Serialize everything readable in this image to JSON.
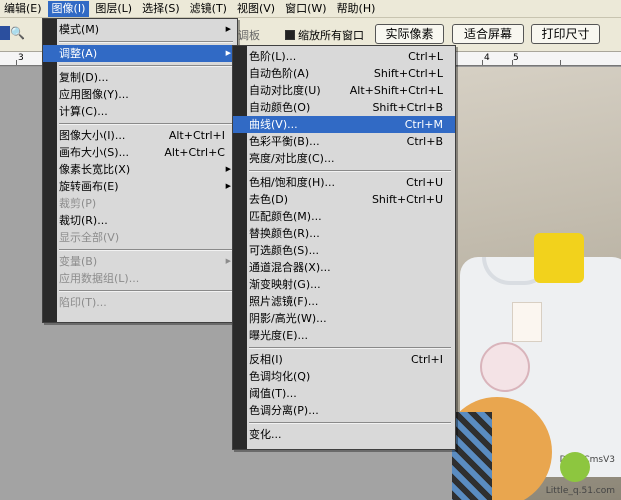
{
  "menubar": {
    "items": [
      {
        "label": "编辑(E)"
      },
      {
        "label": "图像(I)"
      },
      {
        "label": "图层(L)"
      },
      {
        "label": "选择(S)"
      },
      {
        "label": "滤镜(T)"
      },
      {
        "label": "视图(V)"
      },
      {
        "label": "窗口(W)"
      },
      {
        "label": "帮助(H)"
      }
    ],
    "active_index": 1
  },
  "options_bar": {
    "zoom_glyph": "🔍",
    "adjust_label": "调板",
    "zoom_all_windows": "缩放所有窗口",
    "actual_pixels": "实际像素",
    "fit_screen": "适合屏幕",
    "print_size": "打印尺寸"
  },
  "ruler": {
    "ticks": [
      "3",
      "1",
      "4",
      "5"
    ]
  },
  "image_menu": {
    "items": [
      {
        "label": "模式(M)",
        "shortcut": "",
        "submenu": true
      },
      {
        "separator": true
      },
      {
        "label": "调整(A)",
        "shortcut": "",
        "submenu": true,
        "highlight": true
      },
      {
        "separator": true
      },
      {
        "label": "复制(D)...",
        "shortcut": ""
      },
      {
        "label": "应用图像(Y)...",
        "shortcut": ""
      },
      {
        "label": "计算(C)...",
        "shortcut": ""
      },
      {
        "separator": true
      },
      {
        "label": "图像大小(I)...",
        "shortcut": "Alt+Ctrl+I"
      },
      {
        "label": "画布大小(S)...",
        "shortcut": "Alt+Ctrl+C"
      },
      {
        "label": "像素长宽比(X)",
        "shortcut": "",
        "submenu": true
      },
      {
        "label": "旋转画布(E)",
        "shortcut": "",
        "submenu": true
      },
      {
        "label": "裁剪(P)",
        "shortcut": "",
        "disabled": true
      },
      {
        "label": "裁切(R)...",
        "shortcut": ""
      },
      {
        "label": "显示全部(V)",
        "shortcut": "",
        "disabled": true
      },
      {
        "separator": true
      },
      {
        "label": "变量(B)",
        "shortcut": "",
        "submenu": true,
        "disabled": true
      },
      {
        "label": "应用数据组(L)...",
        "shortcut": "",
        "disabled": true
      },
      {
        "separator": true
      },
      {
        "label": "陷印(T)...",
        "shortcut": "",
        "disabled": true
      }
    ]
  },
  "adjust_menu": {
    "items": [
      {
        "label": "色阶(L)...",
        "shortcut": "Ctrl+L"
      },
      {
        "label": "自动色阶(A)",
        "shortcut": "Shift+Ctrl+L"
      },
      {
        "label": "自动对比度(U)",
        "shortcut": "Alt+Shift+Ctrl+L"
      },
      {
        "label": "自动颜色(O)",
        "shortcut": "Shift+Ctrl+B"
      },
      {
        "label": "曲线(V)...",
        "shortcut": "Ctrl+M",
        "highlight": true
      },
      {
        "label": "色彩平衡(B)...",
        "shortcut": "Ctrl+B"
      },
      {
        "label": "亮度/对比度(C)...",
        "shortcut": ""
      },
      {
        "separator": true
      },
      {
        "label": "色相/饱和度(H)...",
        "shortcut": "Ctrl+U"
      },
      {
        "label": "去色(D)",
        "shortcut": "Shift+Ctrl+U"
      },
      {
        "label": "匹配颜色(M)...",
        "shortcut": ""
      },
      {
        "label": "替换颜色(R)...",
        "shortcut": ""
      },
      {
        "label": "可选颜色(S)...",
        "shortcut": ""
      },
      {
        "label": "通道混合器(X)...",
        "shortcut": ""
      },
      {
        "label": "渐变映射(G)...",
        "shortcut": ""
      },
      {
        "label": "照片滤镜(F)...",
        "shortcut": ""
      },
      {
        "label": "阴影/高光(W)...",
        "shortcut": ""
      },
      {
        "label": "曝光度(E)...",
        "shortcut": ""
      },
      {
        "separator": true
      },
      {
        "label": "反相(I)",
        "shortcut": "Ctrl+I"
      },
      {
        "label": "色调均化(Q)",
        "shortcut": ""
      },
      {
        "label": "阈值(T)...",
        "shortcut": ""
      },
      {
        "label": "色调分离(P)...",
        "shortcut": ""
      },
      {
        "separator": true
      },
      {
        "label": "变化...",
        "shortcut": ""
      }
    ]
  },
  "watermark": {
    "site": "DedeCmsV3",
    "credit": "Little_q.51.com"
  },
  "colors": {
    "highlight": "#316ac5",
    "menu_bg": "#d9d9d9",
    "menu_bar": "#2a2a2a"
  }
}
